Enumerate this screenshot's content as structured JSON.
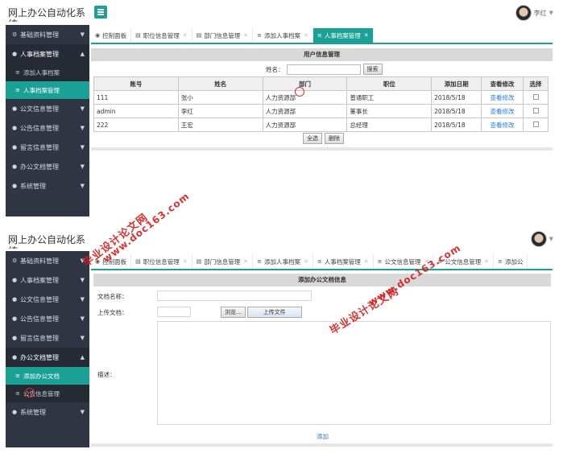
{
  "app_title": "网上办公自动化系统",
  "user_name": "李红",
  "accent_color": "#1aa094",
  "sidebar_color": "#2f3542",
  "screen1": {
    "sidebar": [
      {
        "label": "基础资料管理",
        "icon": "gears-icon",
        "expanded": false
      },
      {
        "label": "人事档案管理",
        "icon": "circle-icon",
        "expanded": true,
        "children": [
          {
            "label": "添加人事档案",
            "active": false
          },
          {
            "label": "人事档案管理",
            "active": true
          }
        ]
      },
      {
        "label": "公文信息管理",
        "icon": "circle-icon",
        "expanded": false
      },
      {
        "label": "公告信息管理",
        "icon": "circle-icon",
        "expanded": false
      },
      {
        "label": "留言信息管理",
        "icon": "circle-icon",
        "expanded": false
      },
      {
        "label": "办公文档管理",
        "icon": "circle-icon",
        "expanded": false
      },
      {
        "label": "系统管理",
        "icon": "circle-icon",
        "expanded": false
      }
    ],
    "tabs": [
      {
        "label": "控制面板",
        "icon": "dashboard-icon",
        "closable": false,
        "active": false
      },
      {
        "label": "职位信息管理",
        "icon": "document-icon",
        "closable": true,
        "active": false
      },
      {
        "label": "部门信息管理",
        "icon": "document-icon",
        "closable": true,
        "active": false
      },
      {
        "label": "添加人事档案",
        "icon": "list-icon",
        "closable": true,
        "active": false
      },
      {
        "label": "人事档案管理",
        "icon": "list-icon",
        "closable": true,
        "active": true
      }
    ],
    "panel_title": "用户信息管理",
    "search_label": "姓名：",
    "search_value": "",
    "search_button": "搜索",
    "table": {
      "headers": [
        "账号",
        "姓名",
        "部门",
        "职位",
        "添加日期",
        "查看修改",
        "选择"
      ],
      "rows": [
        [
          "111",
          "张小",
          "人力资源部",
          "普通职工",
          "2018/5/18",
          "查看修改"
        ],
        [
          "admin",
          "李红",
          "人力资源部",
          "董事长",
          "2018/5/18",
          "查看修改"
        ],
        [
          "222",
          "王宏",
          "人力资源部",
          "总经理",
          "2018/5/18",
          "查看修改"
        ]
      ]
    },
    "select_all_button": "全选",
    "delete_button": "删除"
  },
  "screen2": {
    "sidebar": [
      {
        "label": "基础资料管理",
        "icon": "gears-icon",
        "expanded": false
      },
      {
        "label": "人事档案管理",
        "icon": "circle-icon",
        "expanded": false
      },
      {
        "label": "公文信息管理",
        "icon": "circle-icon",
        "expanded": false
      },
      {
        "label": "公告信息管理",
        "icon": "circle-icon",
        "expanded": false
      },
      {
        "label": "留言信息管理",
        "icon": "circle-icon",
        "expanded": false
      },
      {
        "label": "办公文档管理",
        "icon": "circle-icon",
        "expanded": true,
        "children": [
          {
            "label": "添加办公文档",
            "active": true
          },
          {
            "label": "公告信息管理",
            "active": false
          }
        ]
      },
      {
        "label": "系统管理",
        "icon": "circle-icon",
        "expanded": false
      }
    ],
    "tabs": [
      {
        "label": "控制面板",
        "icon": "dashboard-icon",
        "closable": false,
        "active": false
      },
      {
        "label": "职位信息管理",
        "icon": "document-icon",
        "closable": true,
        "active": false
      },
      {
        "label": "部门信息管理",
        "icon": "document-icon",
        "closable": true,
        "active": false
      },
      {
        "label": "添加人事档案",
        "icon": "list-icon",
        "closable": true,
        "active": false
      },
      {
        "label": "人事档案管理",
        "icon": "list-icon",
        "closable": true,
        "active": false
      },
      {
        "label": "公文信息管理",
        "icon": "list-icon",
        "closable": true,
        "active": false
      },
      {
        "label": "公文信息管理",
        "icon": "list-icon",
        "closable": true,
        "active": false
      },
      {
        "label": "添加公",
        "icon": "list-icon",
        "closable": false,
        "active": false
      }
    ],
    "panel_title": "添加办公文档信息",
    "form": {
      "name_label": "文档名称：",
      "upload_label": "上传文档：",
      "browse_button": "浏览...",
      "upload_button": "上传文件",
      "desc_label": "描述：",
      "submit_label": "添加"
    }
  },
  "watermarks": [
    "毕业设计论文网",
    "www.doc163.com"
  ]
}
